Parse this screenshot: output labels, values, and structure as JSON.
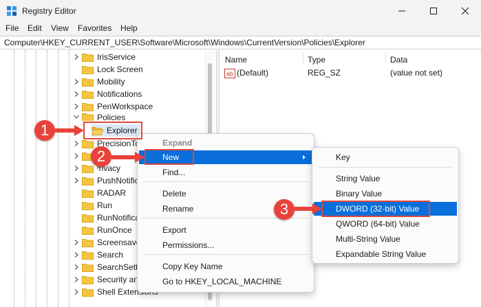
{
  "window": {
    "title": "Registry Editor"
  },
  "menubar": {
    "items": [
      "File",
      "Edit",
      "View",
      "Favorites",
      "Help"
    ]
  },
  "address": {
    "path": "Computer\\HKEY_CURRENT_USER\\Software\\Microsoft\\Windows\\CurrentVersion\\Policies\\Explorer"
  },
  "tree": {
    "items": [
      "IrisService",
      "Lock Screen",
      "Mobility",
      "Notifications",
      "PenWorkspace",
      "Policies",
      "Explorer",
      "PrecisionTo",
      "",
      "Privacy",
      "PushNotific",
      "RADAR",
      "Run",
      "RunNotifica",
      "RunOnce",
      "Screensave",
      "Search",
      "SearchSetti",
      "Security an",
      "Shell Extensions"
    ]
  },
  "values": {
    "columns": [
      "Name",
      "Type",
      "Data"
    ],
    "rows": [
      {
        "name": "(Default)",
        "type": "REG_SZ",
        "data": "(value not set)"
      }
    ]
  },
  "context_menu": {
    "items": [
      "Expand",
      "New",
      "Find...",
      "Delete",
      "Rename",
      "Export",
      "Permissions...",
      "Copy Key Name",
      "Go to HKEY_LOCAL_MACHINE"
    ]
  },
  "submenu": {
    "items": [
      "Key",
      "String Value",
      "Binary Value",
      "DWORD (32-bit) Value",
      "QWORD (64-bit) Value",
      "Multi-String Value",
      "Expandable String Value"
    ]
  },
  "steps": {
    "one": "1",
    "two": "2",
    "three": "3"
  },
  "colors": {
    "highlight": "#0a6fdb",
    "callout": "#e0463a",
    "folder": "#f5c542"
  }
}
